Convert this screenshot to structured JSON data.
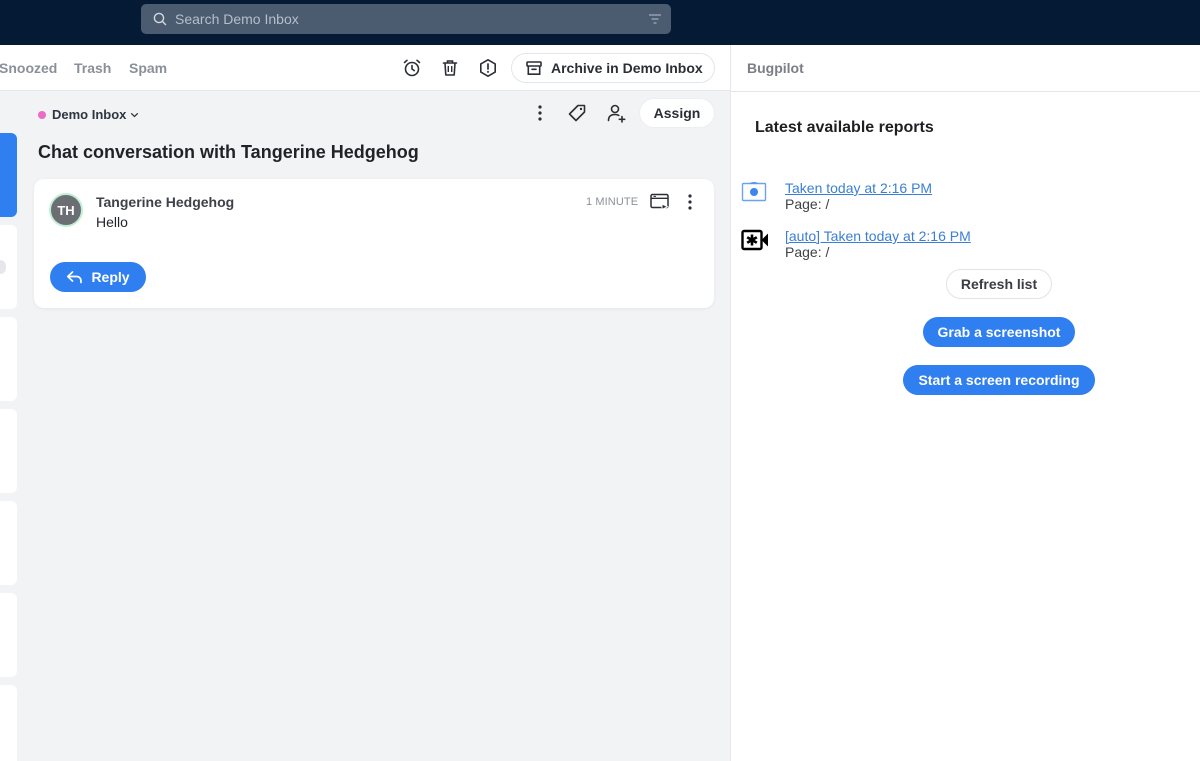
{
  "search": {
    "placeholder": "Search Demo Inbox",
    "icon": "search-icon",
    "filter_icon": "filter-icon"
  },
  "toolbar": {
    "tabs": [
      {
        "label": "Snoozed"
      },
      {
        "label": "Trash"
      },
      {
        "label": "Spam"
      }
    ],
    "icons": [
      "snooze-alarm-icon",
      "trash-icon",
      "spam-warning-icon"
    ],
    "archive_label": "Archive in Demo Inbox"
  },
  "conversation": {
    "inbox_name": "Demo Inbox",
    "inbox_color": "#ec6bc6",
    "assign_label": "Assign",
    "title": "Chat conversation with Tangerine Hedgehog",
    "message": {
      "initials": "TH",
      "sender": "Tangerine Hedgehog",
      "body": "Hello",
      "time": "1 MINUTE",
      "reply_label": "Reply"
    }
  },
  "panel": {
    "title": "Bugpilot",
    "reports_title": "Latest available reports",
    "reports": [
      {
        "icon": "camera-screenshot-icon",
        "label": "Taken today at 2:16 PM",
        "page": "Page: /"
      },
      {
        "icon": "video-recording-icon",
        "label": "[auto] Taken today at 2:16 PM",
        "page": "Page: /"
      }
    ],
    "refresh_label": "Refresh list",
    "screenshot_label": "Grab a screenshot",
    "recording_label": "Start a screen recording"
  },
  "colors": {
    "accent": "#2f7ff0",
    "topbar": "#041a35",
    "link": "#3a7fd5"
  }
}
